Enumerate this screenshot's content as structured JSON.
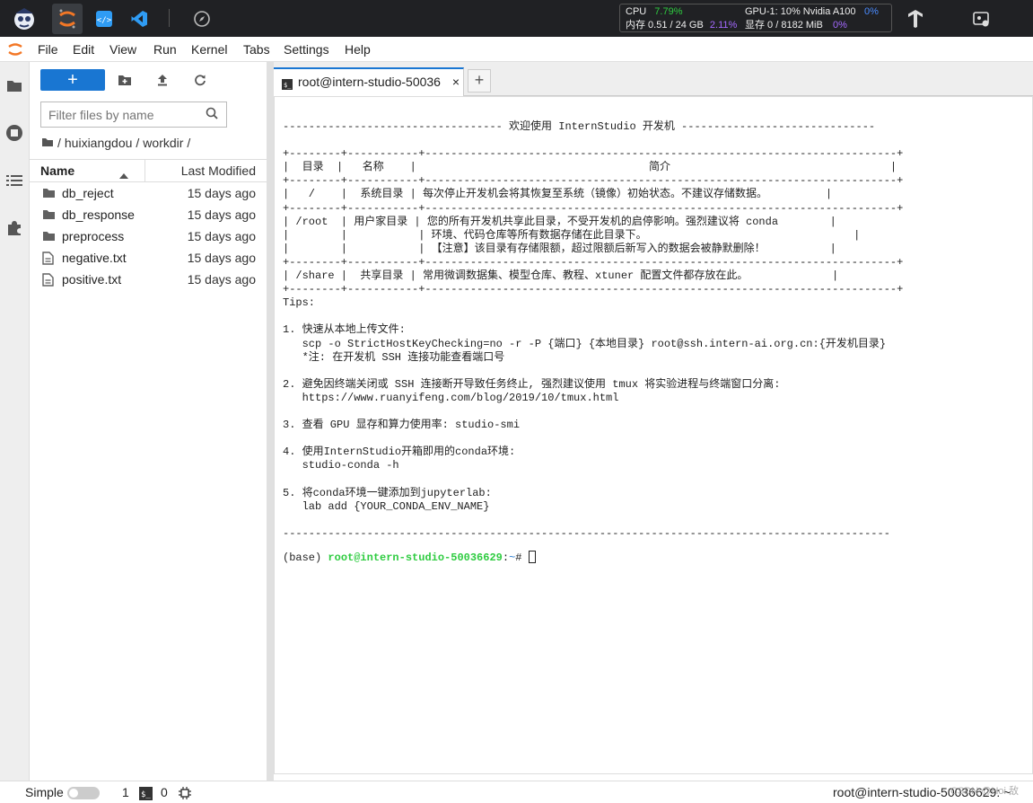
{
  "topbar": {
    "cpu_label": "CPU",
    "cpu_value": "7.79%",
    "mem_label": "内存 0.51 / 24 GB",
    "mem_value": "2.11%",
    "gpu_label": "GPU-1: 10% Nvidia A100",
    "gpu_value": "0%",
    "vram_label": "显存 0 / 8182 MiB",
    "vram_value": "0%"
  },
  "menu": [
    "File",
    "Edit",
    "View",
    "Run",
    "Kernel",
    "Tabs",
    "Settings",
    "Help"
  ],
  "filebrowser": {
    "new_label": "+",
    "filter_placeholder": "Filter files by name",
    "breadcrumb": [
      "/",
      "huixiangdou",
      "/",
      "workdir",
      "/"
    ],
    "col_name": "Name",
    "col_modified": "Last Modified",
    "files": [
      {
        "name": "db_reject",
        "type": "folder",
        "modified": "15 days ago"
      },
      {
        "name": "db_response",
        "type": "folder",
        "modified": "15 days ago"
      },
      {
        "name": "preprocess",
        "type": "folder",
        "modified": "15 days ago"
      },
      {
        "name": "negative.txt",
        "type": "file",
        "modified": "15 days ago"
      },
      {
        "name": "positive.txt",
        "type": "file",
        "modified": "15 days ago"
      }
    ]
  },
  "tab": {
    "label": "root@intern-studio-50036",
    "close": "×",
    "add": "+"
  },
  "terminal": {
    "lines": [
      "---------------------------------- 欢迎使用 InternStudio 开发机 ------------------------------",
      "",
      "+--------+-----------+-------------------------------------------------------------------------+",
      "|  目录  |   名称    |                                    简介                                  |",
      "+--------+-----------+-------------------------------------------------------------------------+",
      "|   /    |  系统目录 | 每次停止开发机会将其恢复至系统（镜像）初始状态。不建议存储数据。         |",
      "+--------+-----------+-------------------------------------------------------------------------+",
      "| /root  | 用户家目录 | 您的所有开发机共享此目录，不受开发机的启停影响。强烈建议将 conda        |",
      "|        |           | 环境、代码仓库等所有数据存储在此目录下。                                |",
      "|        |           | 【注意】该目录有存储限额，超过限额后新写入的数据会被静默删除！          |",
      "+--------+-----------+-------------------------------------------------------------------------+",
      "| /share |  共享目录 | 常用微调数据集、模型仓库、教程、xtuner 配置文件都存放在此。             |",
      "+--------+-----------+-------------------------------------------------------------------------+",
      "Tips:",
      "",
      "1. 快速从本地上传文件:",
      "   scp -o StrictHostKeyChecking=no -r -P {端口} {本地目录} root@ssh.intern-ai.org.cn:{开发机目录}",
      "   *注: 在开发机 SSH 连接功能查看端口号",
      "",
      "2. 避免因终端关闭或 SSH 连接断开导致任务终止, 强烈建议使用 tmux 将实验进程与终端窗口分离:",
      "   https://www.ruanyifeng.com/blog/2019/10/tmux.html",
      "",
      "3. 查看 GPU 显存和算力使用率: studio-smi",
      "",
      "4. 使用InternStudio开箱即用的conda环境:",
      "   studio-conda -h",
      "",
      "5. 将conda环境一键添加到jupyterlab:",
      "   lab add {YOUR_CONDA_ENV_NAME}",
      "",
      "----------------------------------------------------------------------------------------------"
    ],
    "prompt_env": "(base) ",
    "prompt_user": "root@intern-studio-50036629",
    "prompt_sep": ":",
    "prompt_path": "~",
    "prompt_symbol": "# "
  },
  "statusbar": {
    "mode": "Simple",
    "count1": "1",
    "count2": "0",
    "right": "root@intern-studio-50036629: ~",
    "watermark": "CSDN @Hoi 敌"
  }
}
